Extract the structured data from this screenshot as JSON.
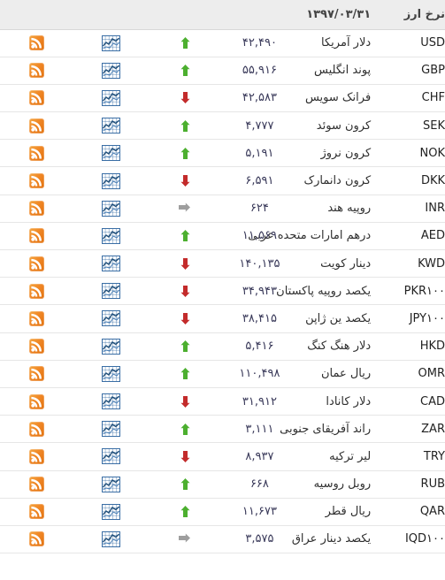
{
  "header": {
    "title": "نرخ ارز",
    "date": "۱۳۹۷/۰۳/۳۱",
    "bg_color": "#ededed"
  },
  "icons": {
    "rss": "rss-feed-icon",
    "chart": "chart-grid-icon",
    "up": "arrow-up-icon",
    "down": "arrow-down-icon",
    "flat": "arrow-right-icon"
  },
  "colors": {
    "up": "#4caf2f",
    "down": "#c32b2b",
    "flat": "#9e9e9e",
    "rss": "#ef8625",
    "chart": "#3a6ea5",
    "row_border": "#e6e6e6"
  },
  "rows": [
    {
      "code": "USD",
      "suffix": "",
      "name": "دلار آمریکا",
      "value": "۴۲,۴۹۰",
      "trend": "up"
    },
    {
      "code": "GBP",
      "suffix": "",
      "name": "پوند انگلیس",
      "value": "۵۵,۹۱۶",
      "trend": "up"
    },
    {
      "code": "CHF",
      "suffix": "",
      "name": "فرانک سویس",
      "value": "۴۲,۵۸۳",
      "trend": "down"
    },
    {
      "code": "SEK",
      "suffix": "",
      "name": "کرون سوئد",
      "value": "۴,۷۷۷",
      "trend": "up"
    },
    {
      "code": "NOK",
      "suffix": "",
      "name": "کرون نروژ",
      "value": "۵,۱۹۱",
      "trend": "up"
    },
    {
      "code": "DKK",
      "suffix": "",
      "name": "کرون دانمارک",
      "value": "۶,۵۹۱",
      "trend": "down"
    },
    {
      "code": "INR",
      "suffix": "",
      "name": "روپیه هند",
      "value": "۶۲۴",
      "trend": "flat"
    },
    {
      "code": "AED",
      "suffix": "",
      "name": "درهم امارات متحده عربی",
      "value": "۱۱,۵۶۹",
      "trend": "up"
    },
    {
      "code": "KWD",
      "suffix": "",
      "name": "دینار کویت",
      "value": "۱۴۰,۱۳۵",
      "trend": "down"
    },
    {
      "code": "PKR",
      "suffix": "۱۰۰",
      "name": "یکصد روپیه پاکستان",
      "value": "۳۴,۹۴۳",
      "trend": "down"
    },
    {
      "code": "JPY",
      "suffix": "۱۰۰",
      "name": "یکصد ین ژاپن",
      "value": "۳۸,۴۱۵",
      "trend": "down"
    },
    {
      "code": "HKD",
      "suffix": "",
      "name": "دلار هنگ کنگ",
      "value": "۵,۴۱۶",
      "trend": "up"
    },
    {
      "code": "OMR",
      "suffix": "",
      "name": "ریال عمان",
      "value": "۱۱۰,۴۹۸",
      "trend": "up"
    },
    {
      "code": "CAD",
      "suffix": "",
      "name": "دلار کانادا",
      "value": "۳۱,۹۱۲",
      "trend": "down"
    },
    {
      "code": "ZAR",
      "suffix": "",
      "name": "راند آفریقای جنوبی",
      "value": "۳,۱۱۱",
      "trend": "up"
    },
    {
      "code": "TRY",
      "suffix": "",
      "name": "لیر ترکیه",
      "value": "۸,۹۳۷",
      "trend": "down"
    },
    {
      "code": "RUB",
      "suffix": "",
      "name": "روبل روسیه",
      "value": "۶۶۸",
      "trend": "up"
    },
    {
      "code": "QAR",
      "suffix": "",
      "name": "ریال قطر",
      "value": "۱۱,۶۷۳",
      "trend": "up"
    },
    {
      "code": "IQD",
      "suffix": "۱۰۰",
      "name": "یکصد دینار عراق",
      "value": "۳,۵۷۵",
      "trend": "flat"
    }
  ]
}
